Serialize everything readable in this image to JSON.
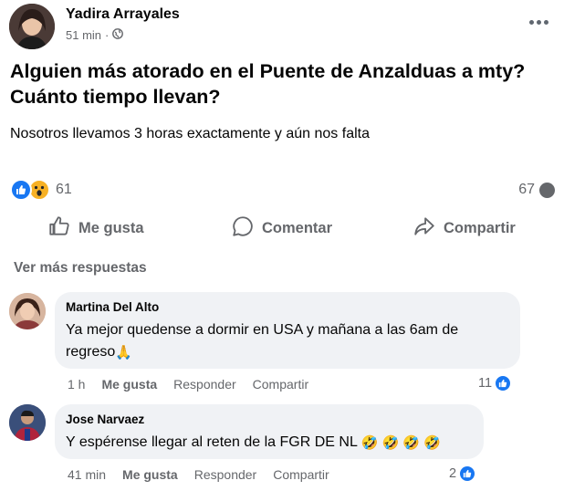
{
  "post": {
    "author": "Yadira Arrayales",
    "time": "51 min",
    "separator": "·",
    "privacy_icon": "globe-icon",
    "title": "Alguien más atorado en el Puente de Anzalduas a mty? Cuánto tiempo llevan?",
    "body": "Nosotros llevamos 3 horas exactamente y aún nos falta",
    "reaction_count": "61",
    "comment_count": "67"
  },
  "actions": {
    "like": "Me gusta",
    "comment": "Comentar",
    "share": "Compartir"
  },
  "more_replies": "Ver más respuestas",
  "comments": [
    {
      "name": "Martina Del Alto",
      "text": "Ya mejor quedense a dormir en USA y mañana a las 6am de regreso",
      "emoji": "🙏",
      "time": "1 h",
      "like": "Me gusta",
      "reply": "Responder",
      "share": "Compartir",
      "reactions": "11"
    },
    {
      "name": "Jose Narvaez",
      "text": "Y espérense llegar al reten de la FGR DE NL",
      "emoji": "🤣 🤣 🤣 🤣",
      "time": "41 min",
      "like": "Me gusta",
      "reply": "Responder",
      "share": "Compartir",
      "reactions": "2"
    }
  ],
  "colors": {
    "accent": "#1877f2",
    "secondary_text": "#65676b",
    "bubble_bg": "#f0f2f5",
    "wow": "#f7b125"
  }
}
